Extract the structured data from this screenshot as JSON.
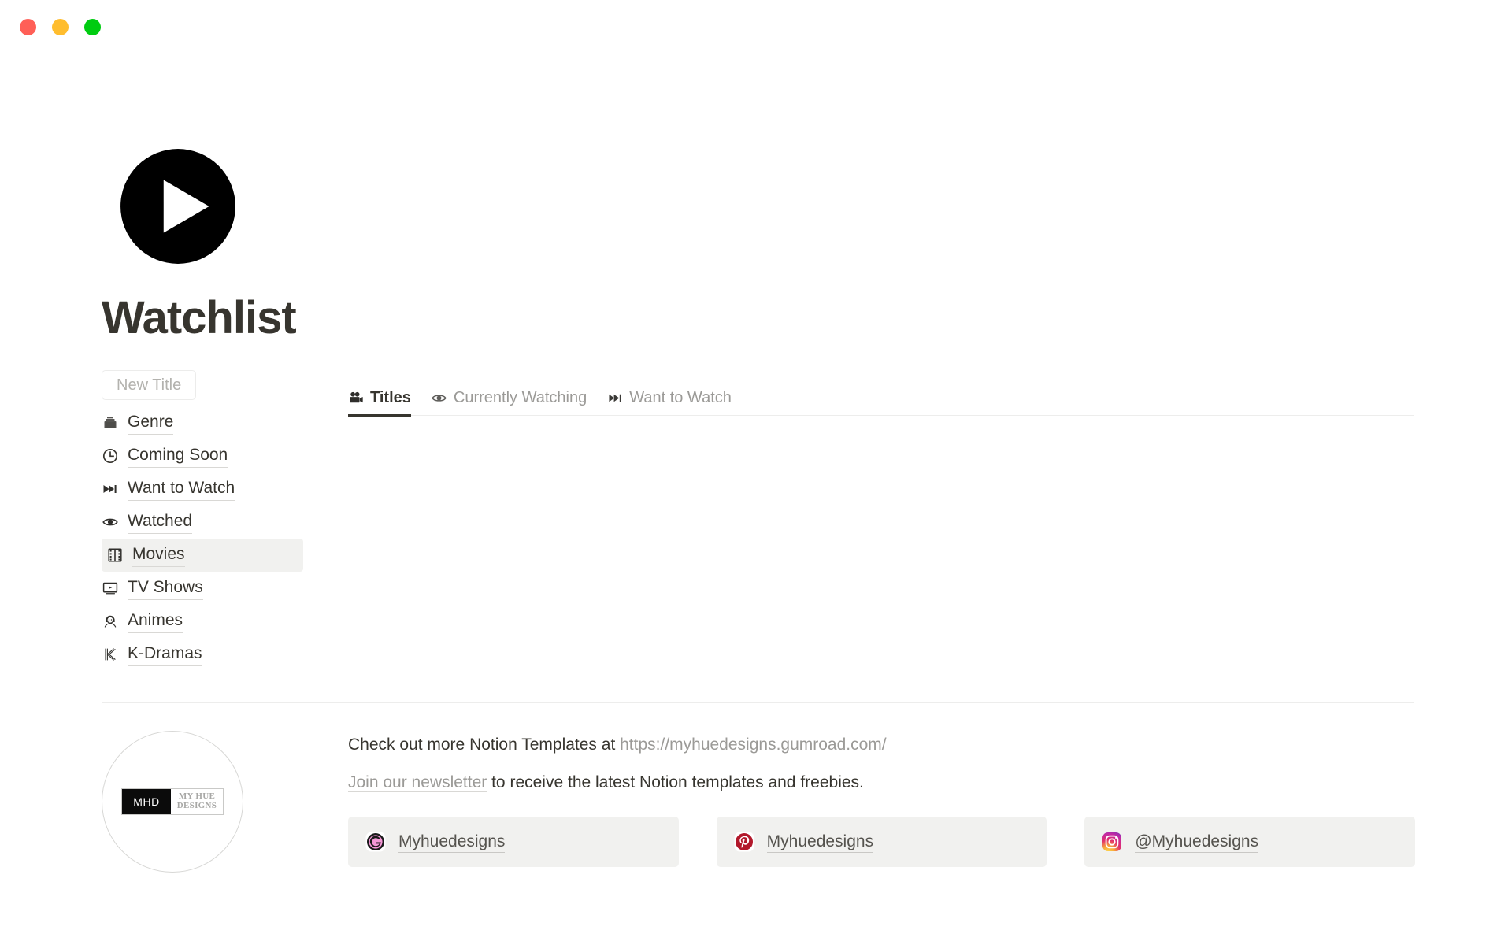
{
  "window": {
    "traffic_lights": [
      {
        "name": "close",
        "color": "#ff5f57"
      },
      {
        "name": "minimize",
        "color": "#ffbd2e"
      },
      {
        "name": "maximize",
        "color": "#00cc11"
      }
    ]
  },
  "header": {
    "icon": "play-button-icon",
    "title": "Watchlist"
  },
  "sidebar": {
    "new_title_label": "New Title",
    "items": [
      {
        "label": "Genre",
        "icon": "card-index-icon",
        "active": false
      },
      {
        "label": "Coming Soon",
        "icon": "clock-icon",
        "active": false
      },
      {
        "label": "Want to Watch",
        "icon": "fast-forward-icon",
        "active": false
      },
      {
        "label": "Watched",
        "icon": "eye-icon",
        "active": false
      },
      {
        "label": "Movies",
        "icon": "film-frames-icon",
        "active": true
      },
      {
        "label": "TV Shows",
        "icon": "television-icon",
        "active": false
      },
      {
        "label": "Animes",
        "icon": "person-bob-hair-icon",
        "active": false
      },
      {
        "label": "K-Dramas",
        "icon": "letter-k-icon",
        "active": false
      }
    ]
  },
  "main": {
    "tabs": [
      {
        "label": "Titles",
        "icon": "movie-camera-icon",
        "active": true
      },
      {
        "label": "Currently Watching",
        "icon": "eye-icon",
        "active": false
      },
      {
        "label": "Want to Watch",
        "icon": "fast-forward-icon",
        "active": false
      }
    ]
  },
  "footer": {
    "logo": {
      "mark": "MHD",
      "line1": "MY HUE",
      "line2": "DESIGNS"
    },
    "promo_prefix": "Check out more Notion Templates at ",
    "promo_link": "https://myhuedesigns.gumroad.com/",
    "newsletter_link": "Join our newsletter",
    "newsletter_suffix": " to receive the latest Notion templates and freebies.",
    "socials": [
      {
        "name": "gumroad",
        "label": "Myhuedesigns",
        "color": "#f497d6"
      },
      {
        "name": "pinterest",
        "label": "Myhuedesigns",
        "color": "#b2182b"
      },
      {
        "name": "instagram",
        "label": "@Myhuedesigns",
        "color": "#e1306c"
      }
    ]
  },
  "colors": {
    "text": "#37352f",
    "muted": "#9b9a97",
    "active_row_bg": "#f1f1ef",
    "divider": "#ededec"
  }
}
